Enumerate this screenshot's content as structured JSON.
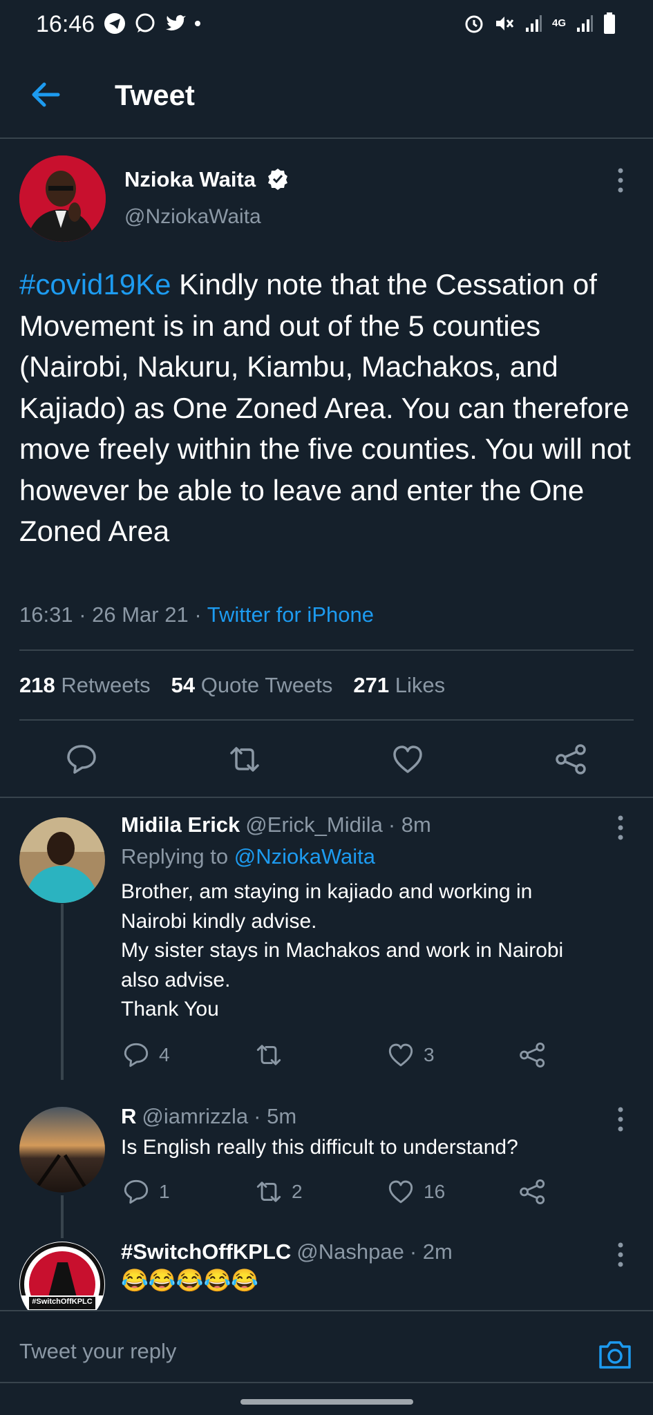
{
  "status_bar": {
    "time": "16:46",
    "left_icons": [
      "telegram-icon",
      "whatsapp-icon",
      "twitter-icon",
      "dot-icon"
    ],
    "right_icons": [
      "alarm-icon",
      "mute-icon",
      "signal-icon",
      "4g-icon",
      "signal-icon",
      "battery-icon"
    ],
    "network": "4G"
  },
  "header": {
    "title": "Tweet"
  },
  "tweet": {
    "author_name": "Nzioka Waita",
    "author_handle": "@NziokaWaita",
    "hashtag": "#covid19Ke",
    "text": " Kindly note that the Cessation of Movement is in and out of the 5 counties (Nairobi, Nakuru, Kiambu, Machakos, and Kajiado) as One Zoned Area. You can therefore move freely within the five counties. You will not however be able to leave and enter the One Zoned Area",
    "time": "16:31",
    "date": "26 Mar 21",
    "source": "Twitter for iPhone",
    "retweets_count": "218",
    "retweets_label": "Retweets",
    "quotes_count": "54",
    "quotes_label": "Quote Tweets",
    "likes_count": "271",
    "likes_label": "Likes"
  },
  "replies": [
    {
      "name": "Midila Erick",
      "handle": "@Erick_Midila",
      "age": "· 8m",
      "replying_label": "Replying to",
      "replying_to": "@NziokaWaita",
      "lines": [
        "Brother, am staying in kajiado and working in",
        "Nairobi kindly advise.",
        "My sister stays in Machakos and work in Nairobi",
        "also advise.",
        "Thank You"
      ],
      "reply_count": "4",
      "retweet_count": "",
      "like_count": "3"
    },
    {
      "name": "R",
      "handle": "@iamrizzla",
      "age": "· 5m",
      "lines": [
        "Is English really this difficult to understand?"
      ],
      "reply_count": "1",
      "retweet_count": "2",
      "like_count": "16"
    },
    {
      "name": "#SwitchOffKPLC",
      "handle": "@Nashpae",
      "age": "· 2m",
      "emojis": "😂😂😂😂😂",
      "avatar_text": "#SwitchOffKPLC"
    }
  ],
  "reply_bar": {
    "placeholder": "Tweet your reply"
  },
  "colors": {
    "background": "#15202b",
    "accent": "#1d9bf0",
    "muted": "#8b98a5",
    "divider": "#38444d"
  }
}
